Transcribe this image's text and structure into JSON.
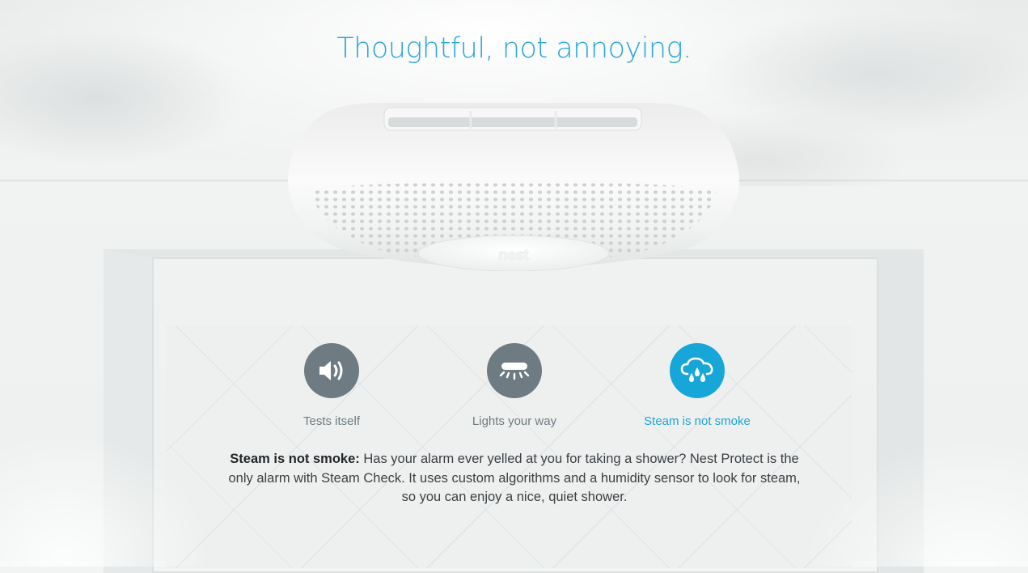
{
  "headline": "Thoughtful, not annoying.",
  "device": {
    "logo_text": "nest"
  },
  "features": [
    {
      "icon": "speaker-icon",
      "label": "Tests itself",
      "active": false
    },
    {
      "icon": "pathlight-icon",
      "label": "Lights your way",
      "active": false
    },
    {
      "icon": "steam-cloud-icon",
      "label": "Steam is not smoke",
      "active": true
    }
  ],
  "description": {
    "heading": "Steam is not smoke:",
    "body": " Has your alarm ever yelled at you for taking a shower? Nest Protect is the only alarm with Steam Check. It uses custom algorithms and a humidity sensor to look for steam, so you can enjoy a nice, quiet shower."
  },
  "colors": {
    "accent": "#16a6d8",
    "inactive_icon_bg": "#6f7b82",
    "headline": "#2aa7d6"
  }
}
